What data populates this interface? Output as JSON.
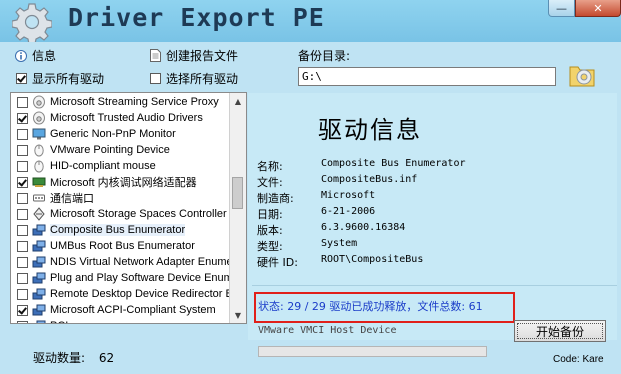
{
  "window": {
    "title": "Driver Export PE",
    "min_label": "—",
    "close_label": "✕"
  },
  "options": {
    "info_label": "信息",
    "show_all_label": "显示所有驱动",
    "show_all_checked": true,
    "create_report_label": "创建报告文件",
    "select_all_label": "选择所有驱动",
    "select_all_checked": false
  },
  "backup": {
    "label": "备份目录:",
    "path": "G:\\"
  },
  "driver_list": {
    "items": [
      {
        "label": "Microsoft Streaming Service Proxy",
        "checked": false,
        "icon": "speaker-icon"
      },
      {
        "label": "Microsoft Trusted Audio Drivers",
        "checked": true,
        "icon": "speaker-icon"
      },
      {
        "label": "Generic Non-PnP Monitor",
        "checked": false,
        "icon": "monitor-icon"
      },
      {
        "label": "VMware Pointing Device",
        "checked": false,
        "icon": "mouse-icon"
      },
      {
        "label": "HID-compliant mouse",
        "checked": false,
        "icon": "mouse-icon"
      },
      {
        "label": "Microsoft 内核调试网络适配器",
        "checked": true,
        "icon": "network-adapter-icon"
      },
      {
        "label": "通信端口",
        "checked": false,
        "icon": "port-icon"
      },
      {
        "label": "Microsoft Storage Spaces Controller",
        "checked": false,
        "icon": "storage-icon"
      },
      {
        "label": "Composite Bus Enumerator",
        "checked": false,
        "icon": "system-device-icon",
        "selected": true
      },
      {
        "label": "UMBus Root Bus Enumerator",
        "checked": false,
        "icon": "system-device-icon"
      },
      {
        "label": "NDIS Virtual Network Adapter Enumer",
        "checked": false,
        "icon": "system-device-icon"
      },
      {
        "label": "Plug and Play Software Device Enume",
        "checked": false,
        "icon": "system-device-icon"
      },
      {
        "label": "Remote Desktop Device Redirector Bu",
        "checked": false,
        "icon": "system-device-icon"
      },
      {
        "label": "Microsoft ACPI-Compliant System",
        "checked": true,
        "icon": "system-device-icon"
      },
      {
        "label": "PCI",
        "checked": false,
        "icon": "system-device-icon"
      }
    ],
    "count_label": "驱动数量:",
    "count_value": "62"
  },
  "info": {
    "title": "驱动信息",
    "fields": [
      {
        "key": "名称:",
        "value": "Composite Bus Enumerator"
      },
      {
        "key": "文件:",
        "value": "CompositeBus.inf"
      },
      {
        "key": "制造商:",
        "value": "Microsoft"
      },
      {
        "key": "日期:",
        "value": "6-21-2006"
      },
      {
        "key": "版本:",
        "value": "6.3.9600.16384"
      },
      {
        "key": "类型:",
        "value": "System"
      },
      {
        "key": "硬件 ID:",
        "value": "ROOT\\CompositeBus"
      }
    ],
    "status": "状态: 29 / 29 驱动已成功释放，文件总数: 61",
    "current_device": "VMware VMCI Host Device",
    "progress_fraction": 0,
    "start_label": "开始备份",
    "credit": "Code: Kare"
  },
  "colors": {
    "status_text": "#1a3cc8",
    "status_border": "#e0201a",
    "panel_bg": "#c7e9f6"
  }
}
